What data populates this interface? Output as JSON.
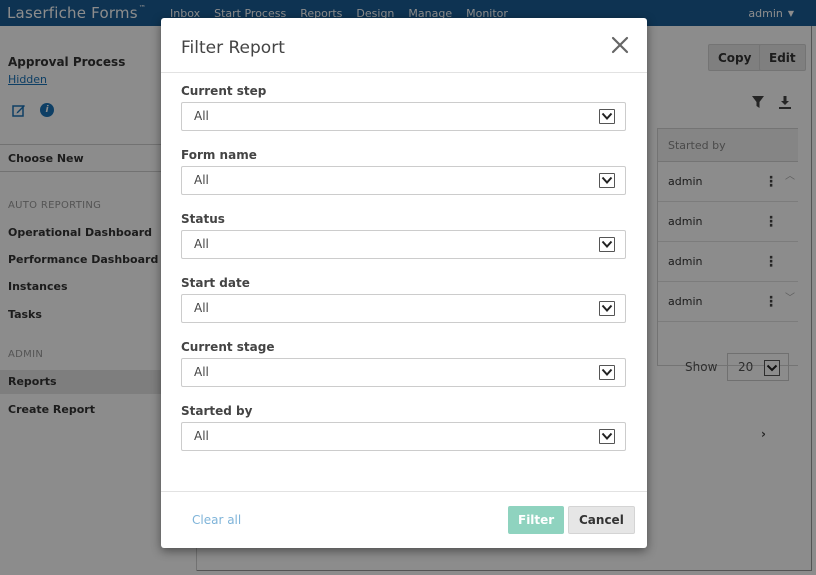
{
  "app": {
    "brand": "Laserfiche Forms",
    "brand_tm": "™",
    "nav": [
      "Inbox",
      "Start Process",
      "Reports",
      "Design",
      "Manage",
      "Monitor"
    ],
    "user": "admin"
  },
  "sidebar": {
    "title": "Approval Process",
    "link": "Hidden",
    "choose_new": "Choose New",
    "section_auto": "AUTO REPORTING",
    "auto_items": [
      "Operational Dashboard",
      "Performance Dashboard",
      "Instances",
      "Tasks"
    ],
    "section_admin": "ADMIN",
    "admin_items": [
      "Reports",
      "Create Report"
    ]
  },
  "main": {
    "copy_label": "Copy",
    "edit_label": "Edit",
    "column_header": "Started by",
    "rows": [
      "admin",
      "admin",
      "admin",
      "admin"
    ],
    "show_label": "Show",
    "show_value": "20"
  },
  "modal": {
    "title": "Filter Report",
    "fields": [
      {
        "label": "Current step",
        "value": "All"
      },
      {
        "label": "Form name",
        "value": "All"
      },
      {
        "label": "Status",
        "value": "All"
      },
      {
        "label": "Start date",
        "value": "All"
      },
      {
        "label": "Current stage",
        "value": "All"
      },
      {
        "label": "Started by",
        "value": "All"
      }
    ],
    "clear_label": "Clear all",
    "filter_label": "Filter",
    "cancel_label": "Cancel"
  },
  "colors": {
    "topbar": "#1b5e96",
    "link": "#1a73b8",
    "filter_button": "#8fd3bf",
    "clear_link": "#7fb4d9"
  }
}
